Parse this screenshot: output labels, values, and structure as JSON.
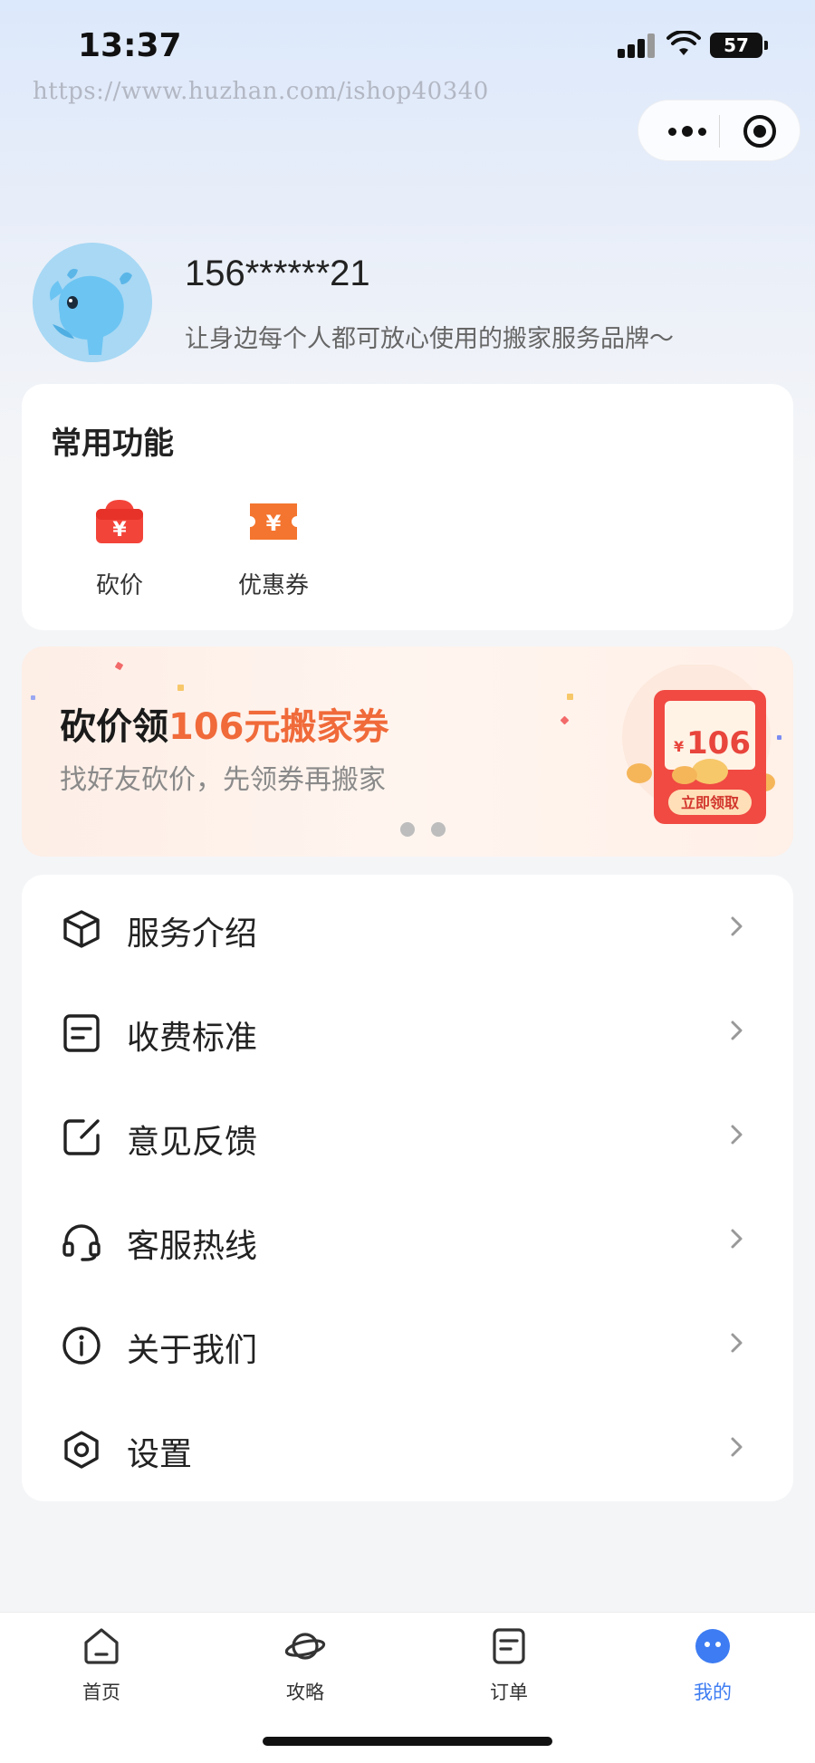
{
  "status_bar": {
    "time": "13:37",
    "battery": "57",
    "icons": [
      "signal-icon",
      "wifi-icon",
      "battery-icon"
    ]
  },
  "watermark": "https://www.huzhan.com/ishop40340",
  "capsule": {
    "icons": [
      "more-icon",
      "close-target-icon"
    ]
  },
  "profile": {
    "name": "156******21",
    "slogan": "让身边每个人都可放心使用的搬家服务品牌～"
  },
  "common_functions": {
    "title": "常用功能",
    "items": [
      {
        "label": "砍价",
        "icon": "bargain-icon"
      },
      {
        "label": "优惠券",
        "icon": "coupon-icon"
      }
    ]
  },
  "banner": {
    "title_prefix": "砍价领",
    "title_accent": "106元搬家券",
    "subtitle": "找好友砍价，先领券再搬家",
    "coupon_amount": "¥106",
    "coupon_button": "立即领取",
    "page_count": 2
  },
  "menu": {
    "items": [
      {
        "label": "服务介绍",
        "icon": "cube-icon"
      },
      {
        "label": "收费标准",
        "icon": "document-icon"
      },
      {
        "label": "意见反馈",
        "icon": "edit-icon"
      },
      {
        "label": "客服热线",
        "icon": "headset-icon"
      },
      {
        "label": "关于我们",
        "icon": "info-icon"
      },
      {
        "label": "设置",
        "icon": "settings-icon"
      }
    ]
  },
  "tab_bar": {
    "items": [
      {
        "label": "首页",
        "icon": "home-icon",
        "active": false
      },
      {
        "label": "攻略",
        "icon": "planet-icon",
        "active": false
      },
      {
        "label": "订单",
        "icon": "order-icon",
        "active": false
      },
      {
        "label": "我的",
        "icon": "profile-face-icon",
        "active": true
      }
    ],
    "active_color": "#3d7cf2"
  },
  "colors": {
    "accent": "#f06a3a",
    "brand_blue": "#3d7cf2"
  }
}
